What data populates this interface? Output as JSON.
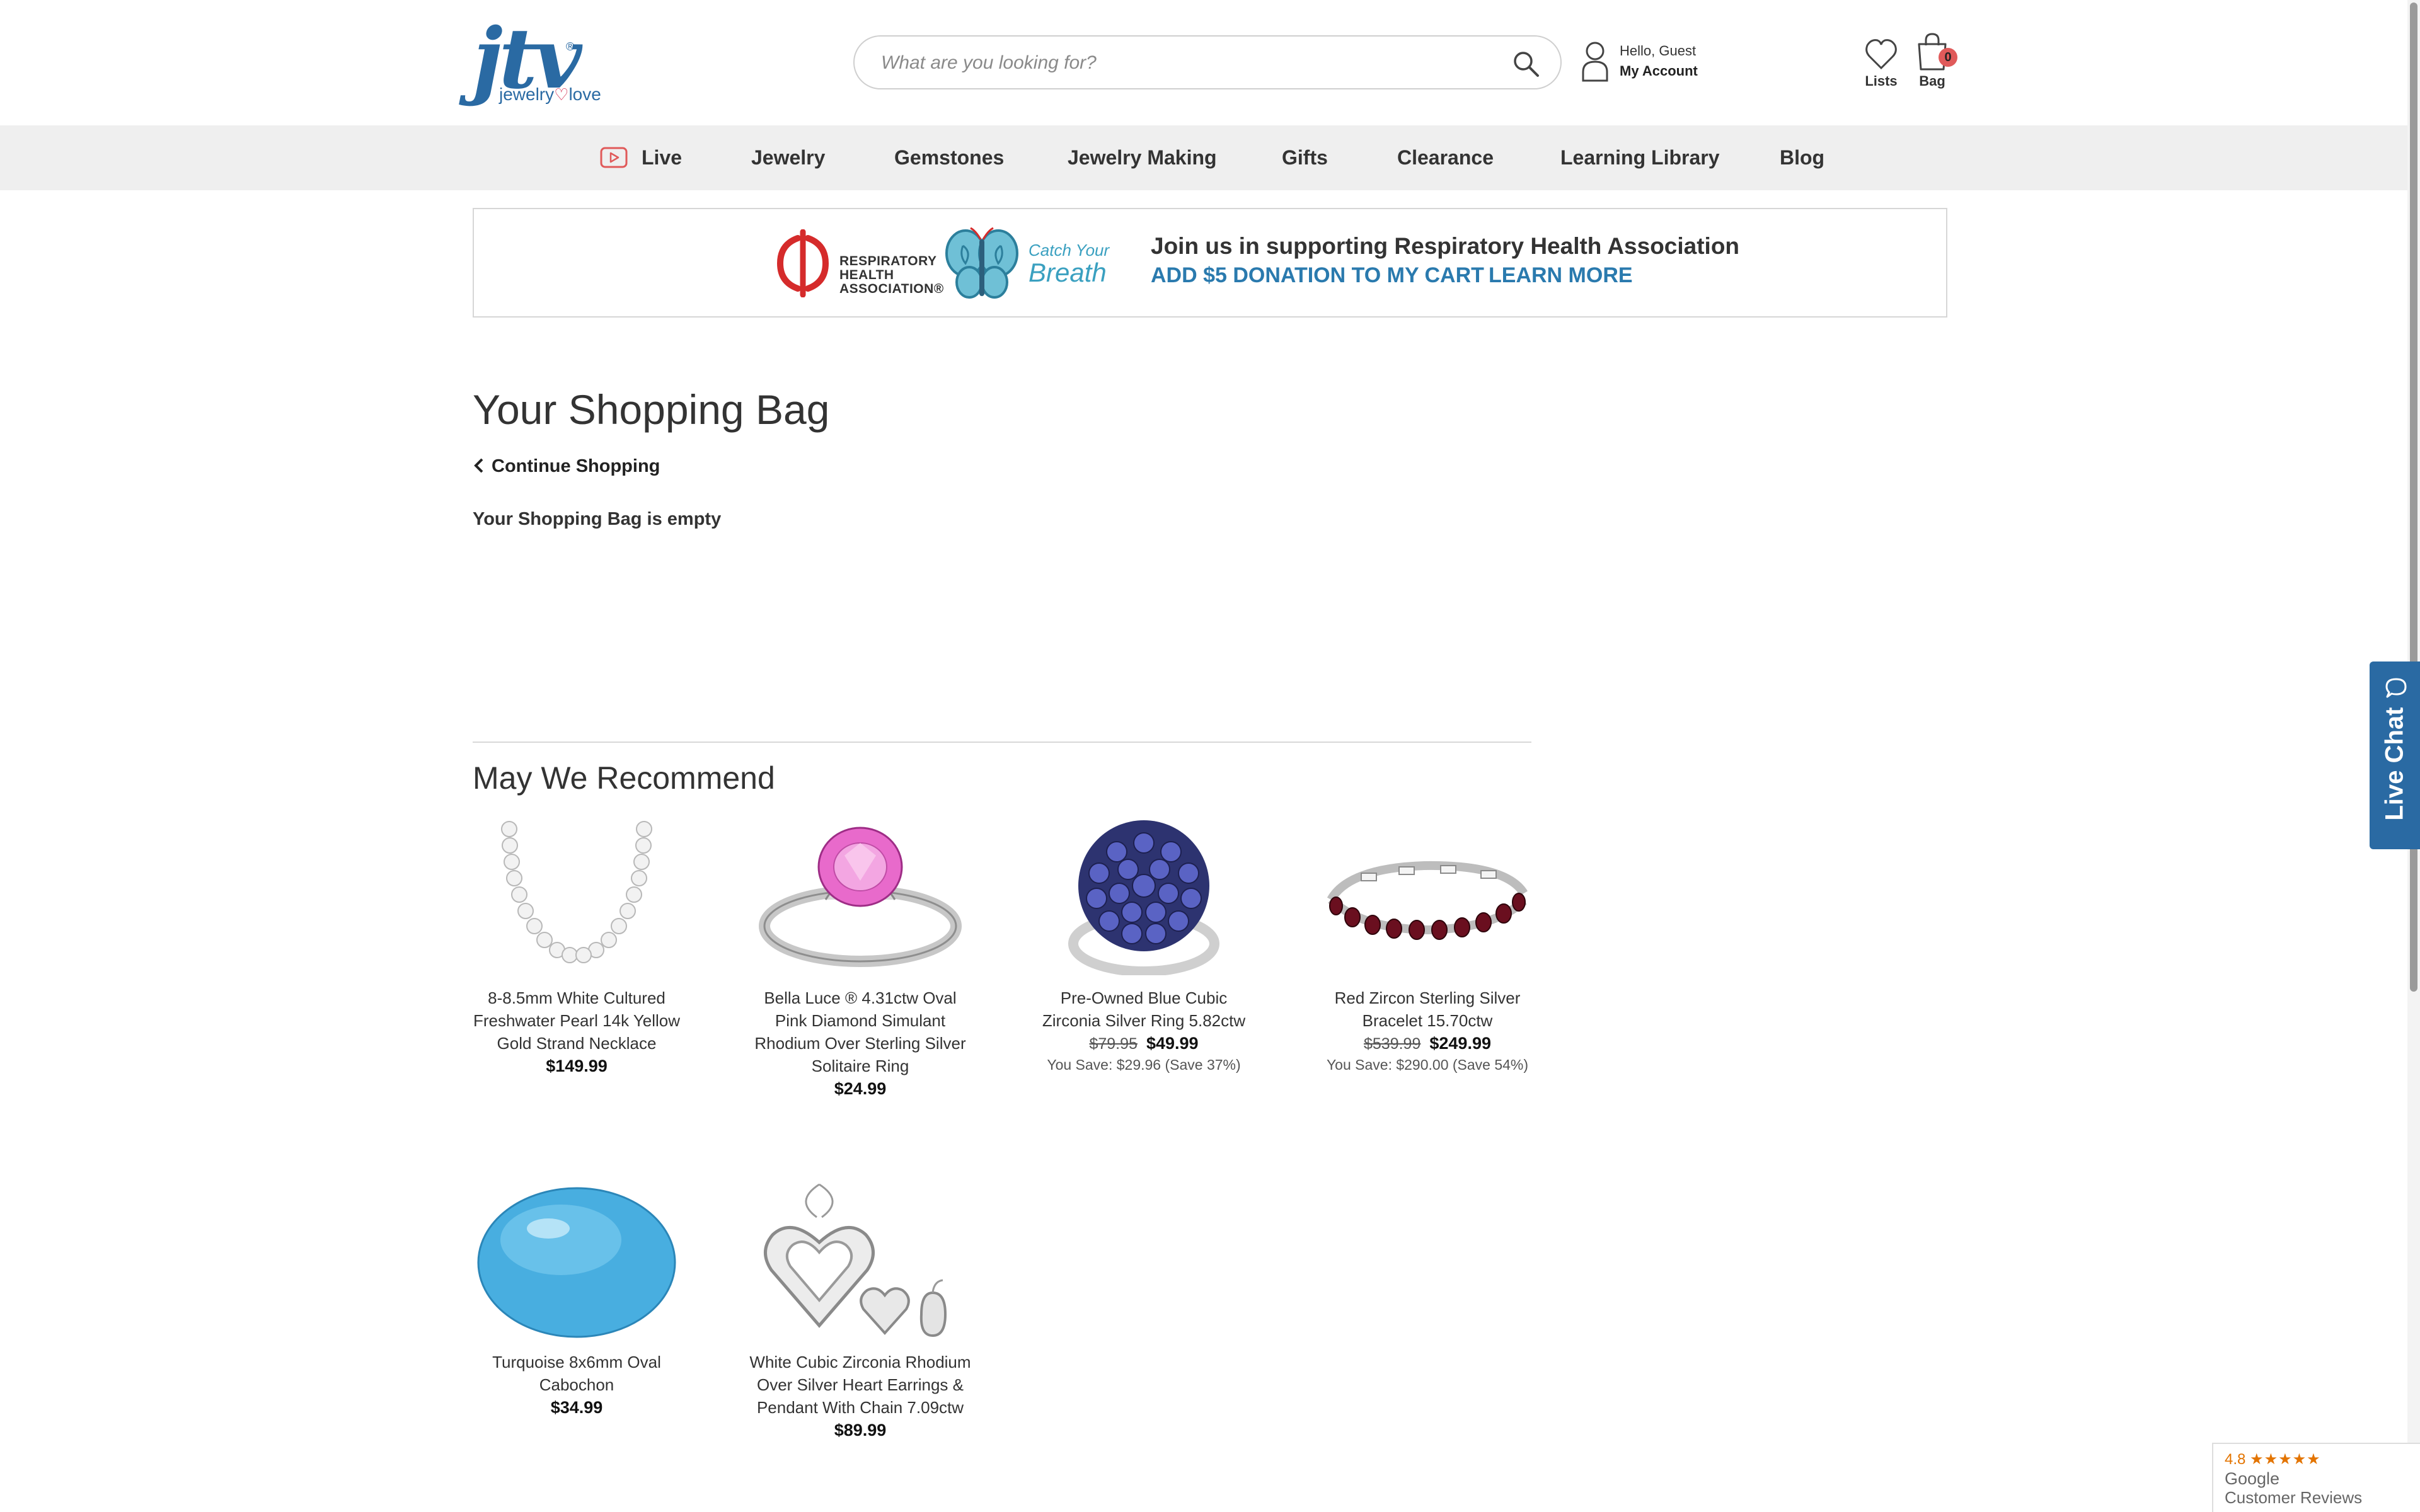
{
  "header": {
    "logo_text": "jtv",
    "logo_reg": "®",
    "logo_tagline_a": "jewelry",
    "logo_tagline_b": "love",
    "search_placeholder": "What are you looking for?",
    "greeting": "Hello, Guest",
    "account_label": "My Account",
    "lists_label": "Lists",
    "bag_label": "Bag",
    "bag_count": "0"
  },
  "nav": {
    "items": [
      {
        "label": "Live"
      },
      {
        "label": "Jewelry"
      },
      {
        "label": "Gemstones"
      },
      {
        "label": "Jewelry Making"
      },
      {
        "label": "Gifts"
      },
      {
        "label": "Clearance"
      },
      {
        "label": "Learning Library"
      },
      {
        "label": "Blog"
      }
    ]
  },
  "banner": {
    "org_line1": "RESPIRATORY",
    "org_line2": "HEALTH",
    "org_line3": "ASSOCIATION",
    "org_reg": "®",
    "catch_text": "Catch Your",
    "breath_text": "Breath",
    "headline": "Join us in supporting Respiratory Health Association",
    "donate_label": "ADD $5 DONATION TO MY CART",
    "learn_label": "LEARN MORE"
  },
  "main": {
    "title": "Your Shopping Bag",
    "continue_label": "Continue Shopping",
    "empty_message": "Your Shopping Bag is empty",
    "recommend_title": "May We Recommend"
  },
  "products": [
    {
      "name": "8-8.5mm White Cultured Freshwater Pearl 14k Yellow Gold Strand Necklace",
      "price": "$149.99",
      "old_price": "",
      "savings": ""
    },
    {
      "name": "Bella Luce ® 4.31ctw Oval Pink Diamond Simulant Rhodium Over Sterling Silver Solitaire Ring",
      "price": "$24.99",
      "old_price": "",
      "savings": ""
    },
    {
      "name": "Pre-Owned Blue Cubic Zirconia Silver Ring 5.82ctw",
      "price": "$49.99",
      "old_price": "$79.95",
      "savings": "You Save: $29.96 (Save 37%)"
    },
    {
      "name": "Red Zircon Sterling Silver Bracelet 15.70ctw",
      "price": "$249.99",
      "old_price": "$539.99",
      "savings": "You Save: $290.00 (Save 54%)"
    },
    {
      "name": "Turquoise 8x6mm Oval Cabochon",
      "price": "$34.99",
      "old_price": "",
      "savings": ""
    },
    {
      "name": "White Cubic Zirconia Rhodium Over Silver Heart Earrings & Pendant With Chain 7.09ctw",
      "price": "$89.99",
      "old_price": "",
      "savings": ""
    }
  ],
  "live_chat": {
    "label": "Live Chat"
  },
  "google_badge": {
    "rating": "4.8",
    "stars": "★★★★★",
    "brand": "Google",
    "caption": "Customer Reviews"
  },
  "icons": {
    "search": "search-icon",
    "user": "user-icon",
    "lists": "heart-icon",
    "bag": "bag-icon",
    "live": "play-icon",
    "back": "chevron-left-icon",
    "chat": "chat-bubble-icon"
  },
  "colors": {
    "brand_blue": "#2a6aa3",
    "link_blue": "#2a7aae",
    "nav_bg": "#efefef",
    "accent_red": "#d2264b",
    "badge_red": "#e05a5a"
  }
}
